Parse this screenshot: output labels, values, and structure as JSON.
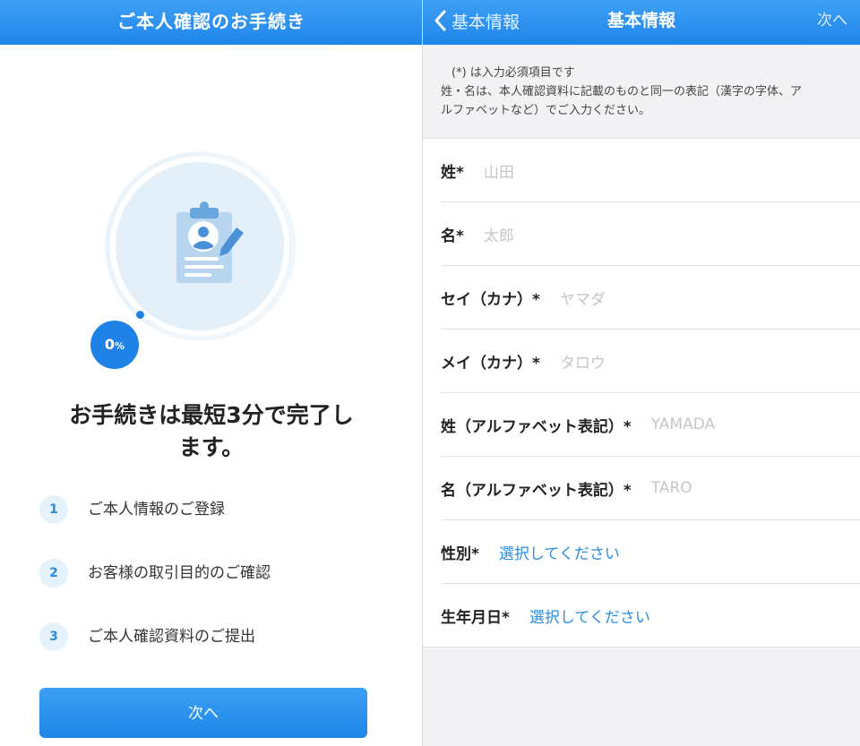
{
  "left": {
    "header": {
      "title": "ご本人確認のお手続き"
    },
    "progress": {
      "value": "0",
      "unit": "%"
    },
    "headline": {
      "line1": "お手続きは最短3分で完了し",
      "line2": "ます。"
    },
    "steps": [
      {
        "num": "1",
        "label": "ご本人情報のご登録"
      },
      {
        "num": "2",
        "label": "お客様の取引目的のご確認"
      },
      {
        "num": "3",
        "label": "ご本人確認資料のご提出"
      }
    ],
    "next_button": "次へ"
  },
  "right": {
    "header": {
      "back_label": "基本情報",
      "title": "基本情報",
      "next_label": "次へ"
    },
    "notice": {
      "line1": "(*) は入力必須項目です",
      "line2": "姓・名は、本人確認資料に記載のものと同一の表記（漢字の字体、ア",
      "line3": "ルファベットなど）でご入力ください。"
    },
    "fields": [
      {
        "label": "姓*",
        "placeholder": "山田"
      },
      {
        "label": "名*",
        "placeholder": "太郎"
      },
      {
        "label": "セイ（カナ）*",
        "placeholder": "ヤマダ"
      },
      {
        "label": "メイ（カナ）*",
        "placeholder": "タロウ"
      },
      {
        "label": "姓（アルファベット表記）*",
        "placeholder": "YAMADA"
      },
      {
        "label": "名（アルファベット表記）*",
        "placeholder": "TARO"
      },
      {
        "label": "性別*",
        "value": "選択してください"
      },
      {
        "label": "生年月日*",
        "value": "選択してください"
      }
    ]
  },
  "colors": {
    "primary": "#1f86ea",
    "link": "#2a8de0",
    "placeholder": "#c6c6c6"
  },
  "icons": {
    "illustration": "clipboard-profile-icon",
    "back": "chevron-left-icon"
  }
}
